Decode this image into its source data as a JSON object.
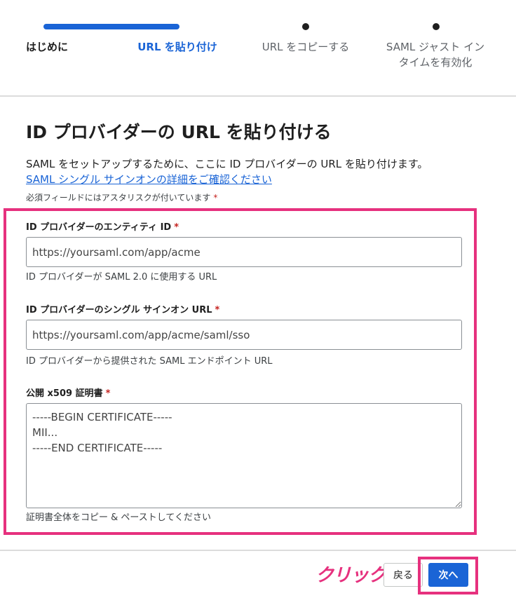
{
  "steps": [
    {
      "label": "はじめに",
      "state": "done"
    },
    {
      "label": "URL を貼り付け",
      "state": "active"
    },
    {
      "label": "URL をコピーする",
      "state": "todo"
    },
    {
      "label": "SAML ジャスト イン タイムを有効化",
      "state": "todo"
    }
  ],
  "main": {
    "title": "ID プロバイダーの URL を貼り付ける",
    "description": "SAML をセットアップするために、ここに ID プロバイダーの URL を貼り付けます。",
    "help_link": "SAML シングル サインオンの詳細をご確認ください",
    "required_note": "必須フィールドにはアスタリスクが付いています",
    "required_star": "*"
  },
  "form": {
    "entity_id": {
      "label": "ID プロバイダーのエンティティ ID",
      "value": "https://yoursaml.com/app/acme",
      "hint": "ID プロバイダーが SAML 2.0 に使用する URL"
    },
    "sso_url": {
      "label": "ID プロバイダーのシングル サインオン URL",
      "value": "https://yoursaml.com/app/acme/saml/sso",
      "hint": "ID プロバイダーから提供された SAML エンドポイント URL"
    },
    "certificate": {
      "label": "公開 x509 証明書",
      "value": "-----BEGIN CERTIFICATE-----\nMII...\n-----END CERTIFICATE-----",
      "hint": "証明書全体をコピー & ペーストしてください"
    }
  },
  "footer": {
    "annotation": "クリック",
    "back_label": "戻る",
    "next_label": "次へ"
  },
  "colors": {
    "accent": "#1a64d6",
    "highlight": "#e6317e",
    "required": "#c5221f"
  }
}
